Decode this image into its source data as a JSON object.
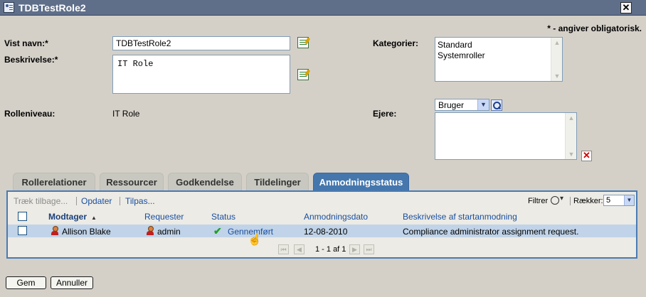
{
  "window": {
    "title": "TDBTestRole2"
  },
  "required_note": "* - angiver obligatorisk.",
  "form": {
    "display_name": {
      "label": "Vist navn:*",
      "value": "TDBTestRole2"
    },
    "description": {
      "label": "Beskrivelse:*",
      "value": "IT Role"
    },
    "role_level": {
      "label": "Rolleniveau:",
      "value": "IT Role"
    },
    "categories": {
      "label": "Kategorier:",
      "options": [
        "Standard",
        "Systemroller"
      ]
    },
    "owners": {
      "label": "Ejere:",
      "type_select": "Bruger"
    }
  },
  "tabs": [
    {
      "label": "Rollerelationer",
      "active": false
    },
    {
      "label": "Ressourcer",
      "active": false
    },
    {
      "label": "Godkendelse",
      "active": false
    },
    {
      "label": "Tildelinger",
      "active": false
    },
    {
      "label": "Anmodningsstatus",
      "active": true
    }
  ],
  "toolbar": {
    "retract": "Træk tilbage...",
    "refresh": "Opdater",
    "customize": "Tilpas...",
    "filter": "Filtrer",
    "rows_label": "Rækker:",
    "rows_value": "5"
  },
  "table": {
    "columns": [
      "Modtager",
      "Requester",
      "Status",
      "Anmodningsdato",
      "Beskrivelse af startanmodning"
    ],
    "rows": [
      {
        "recipient": "Allison Blake",
        "requester": "admin",
        "status": "Gennemført",
        "date": "12-08-2010",
        "description": "Compliance administrator assignment request."
      }
    ]
  },
  "pager": {
    "text": "1 - 1 af 1"
  },
  "buttons": {
    "save": "Gem",
    "cancel": "Annuller"
  },
  "colors": {
    "titlebar": "#5f6f8a",
    "active_tab": "#4577ad",
    "selected_row": "#c0d3e8",
    "link": "#1a4fa0"
  }
}
